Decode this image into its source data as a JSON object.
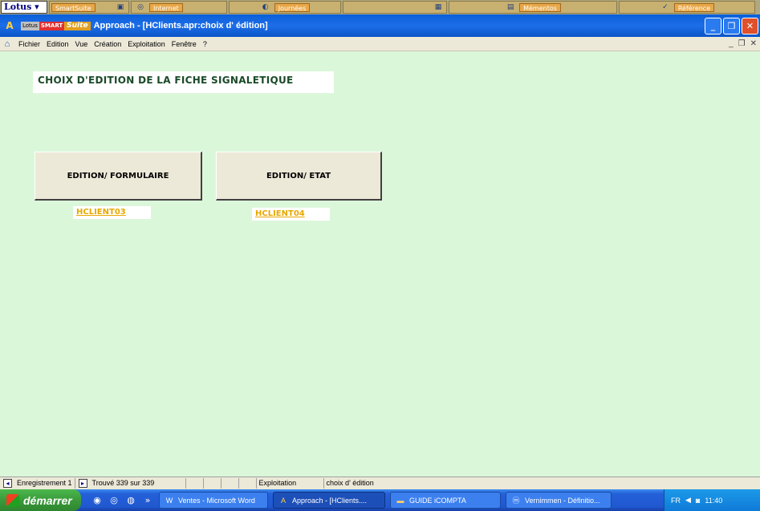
{
  "suite_bar": {
    "lotus_menu": "Lotus",
    "drawers": [
      {
        "label": "SmartSuite",
        "icon": "smartsuite-drawer-icon"
      },
      {
        "label": "Internet",
        "icon": "internet-drawer-icon"
      },
      {
        "label": "Journées",
        "icon": "journees-drawer-icon"
      },
      {
        "label": "",
        "icon": "calendar-drawer-icon"
      },
      {
        "label": "Mémentos",
        "icon": "mementos-drawer-icon"
      },
      {
        "label": "Référence",
        "icon": "reference-drawer-icon"
      }
    ]
  },
  "window": {
    "brand_lotus": "Lotus",
    "brand_smart": "SMART",
    "brand_suite": "Suite",
    "title": "Approach - [HClients.apr:choix d' édition]"
  },
  "menu": {
    "items": [
      "Fichier",
      "Edition",
      "Vue",
      "Création",
      "Exploitation",
      "Fenêtre",
      "?"
    ]
  },
  "form": {
    "heading": "CHOIX D'EDITION DE LA FICHE SIGNALETIQUE",
    "button_formulaire": "EDITION/ FORMULAIRE",
    "button_etat": "EDITION/ ETAT",
    "link_1": "HCLIENT03",
    "link_2": "HCLIENT04",
    "background_color": "#dbf7da"
  },
  "status_bar": {
    "record": "Enregistrement 1",
    "found": "Trouvé 339 sur 339",
    "mode": "Exploitation",
    "view": "choix d' édition"
  },
  "taskbar": {
    "start": "démarrer",
    "tasks": [
      {
        "label": "Ventes - Microsoft Word",
        "icon": "word-icon"
      },
      {
        "label": "Approach - [HClients....",
        "icon": "approach-icon"
      },
      {
        "label": "GUIDE iCOMPTA",
        "icon": "folder-icon"
      },
      {
        "label": "Vernimmen - Définitio...",
        "icon": "browser-icon"
      }
    ],
    "language": "FR",
    "clock": "11:40"
  }
}
